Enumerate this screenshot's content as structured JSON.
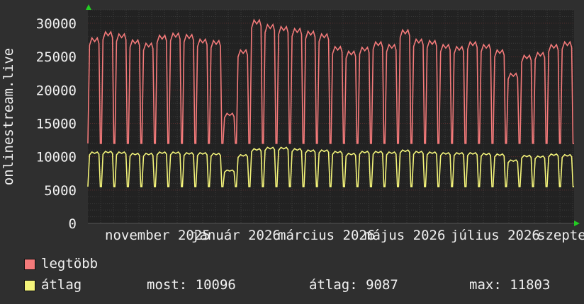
{
  "chart_data": {
    "type": "line",
    "ylabel": "onlinestream.live",
    "ylim": [
      0,
      32000
    ],
    "y_ticks": [
      0,
      5000,
      10000,
      15000,
      20000,
      25000,
      30000
    ],
    "x_ticks": [
      "november 2025",
      "január 2026",
      "március 2026",
      "május 2026",
      "július 2026",
      "szeptember"
    ],
    "grid": true,
    "legend_position": "bottom-left",
    "series": [
      {
        "name": "legtöbb",
        "color": "#f47a7a",
        "baseline_low": 12000,
        "weekly_peaks": [
          27800,
          28700,
          28400,
          27500,
          27000,
          28200,
          28500,
          28300,
          27600,
          27400,
          16500,
          26000,
          30500,
          29800,
          29500,
          29200,
          28800,
          28400,
          26500,
          25800,
          26400,
          27200,
          26800,
          29000,
          27600,
          27400,
          26800,
          26500,
          27200,
          26800,
          26000,
          22500,
          25200,
          25600,
          26800,
          27200
        ]
      },
      {
        "name": "átlag",
        "color": "#f4f47a",
        "baseline_low": 5500,
        "weekly_peaks": [
          10700,
          10800,
          10700,
          10500,
          10500,
          10700,
          10700,
          10600,
          10600,
          10500,
          8000,
          10300,
          11200,
          11400,
          11400,
          11200,
          11000,
          11000,
          10800,
          10500,
          10800,
          10800,
          10700,
          11000,
          10800,
          10700,
          10600,
          10600,
          10600,
          10500,
          10400,
          9500,
          10200,
          10100,
          10400,
          10300
        ],
        "stats": {
          "most": "most: 10096",
          "atlag": "átlag: 9087",
          "max": "max: 11803"
        }
      }
    ]
  }
}
